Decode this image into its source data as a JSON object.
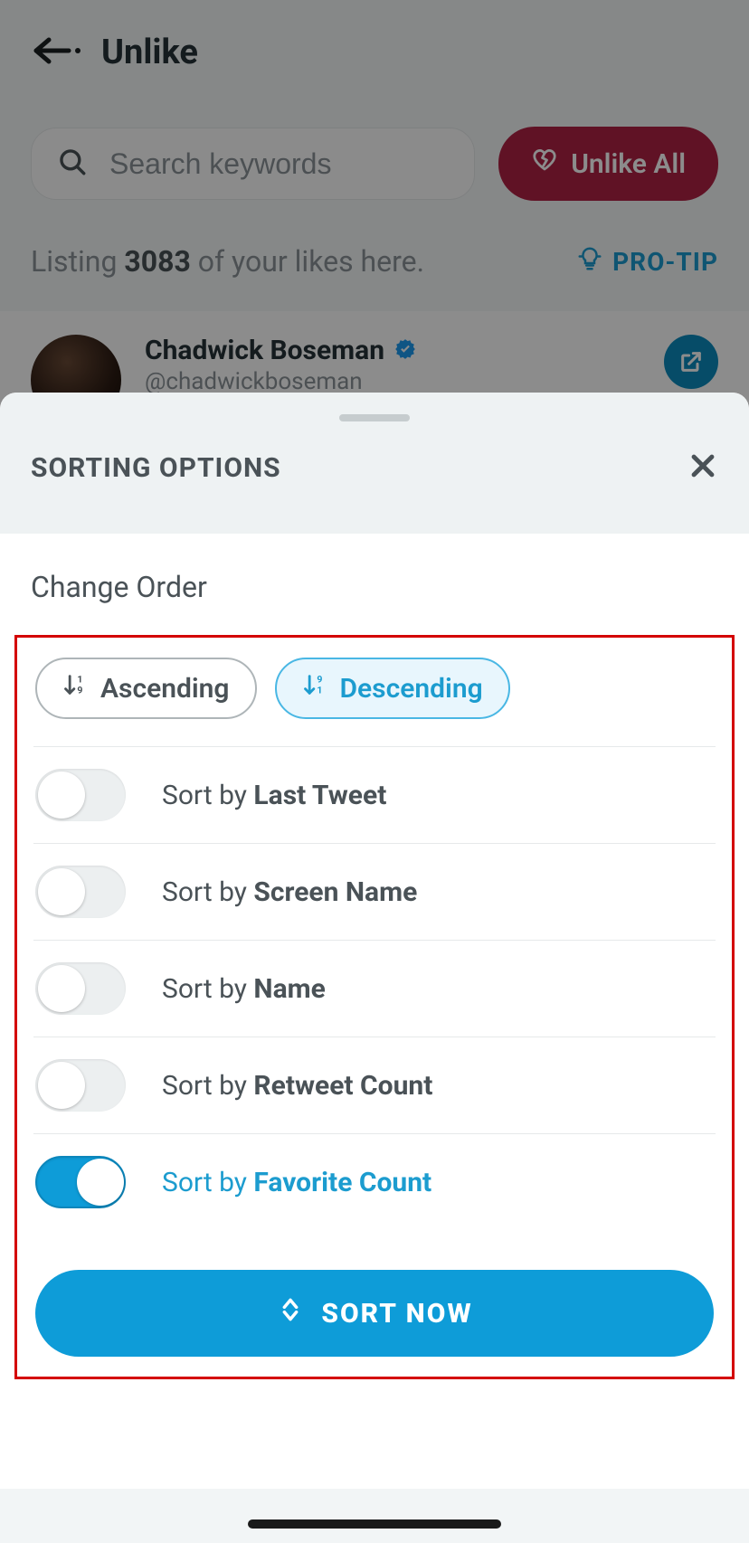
{
  "header": {
    "title": "Unlike"
  },
  "search": {
    "placeholder": "Search keywords"
  },
  "unlike_all_label": "Unlike All",
  "listing": {
    "prefix": "Listing ",
    "count": "3083",
    "suffix": " of your likes here."
  },
  "protip_label": "PRO-TIP",
  "item": {
    "name": "Chadwick Boseman",
    "handle": "@chadwickboseman"
  },
  "sheet": {
    "title": "SORTING OPTIONS",
    "change_order": "Change Order",
    "asc_label": "Ascending",
    "desc_label": "Descending",
    "options": [
      {
        "prefix": "Sort by ",
        "name": "Last Tweet",
        "enabled": false
      },
      {
        "prefix": "Sort by ",
        "name": "Screen Name",
        "enabled": false
      },
      {
        "prefix": "Sort by ",
        "name": "Name",
        "enabled": false
      },
      {
        "prefix": "Sort by ",
        "name": "Retweet Count",
        "enabled": false
      },
      {
        "prefix": "Sort by ",
        "name": "Favorite Count",
        "enabled": true
      }
    ],
    "sort_now_label": "SORT NOW"
  }
}
